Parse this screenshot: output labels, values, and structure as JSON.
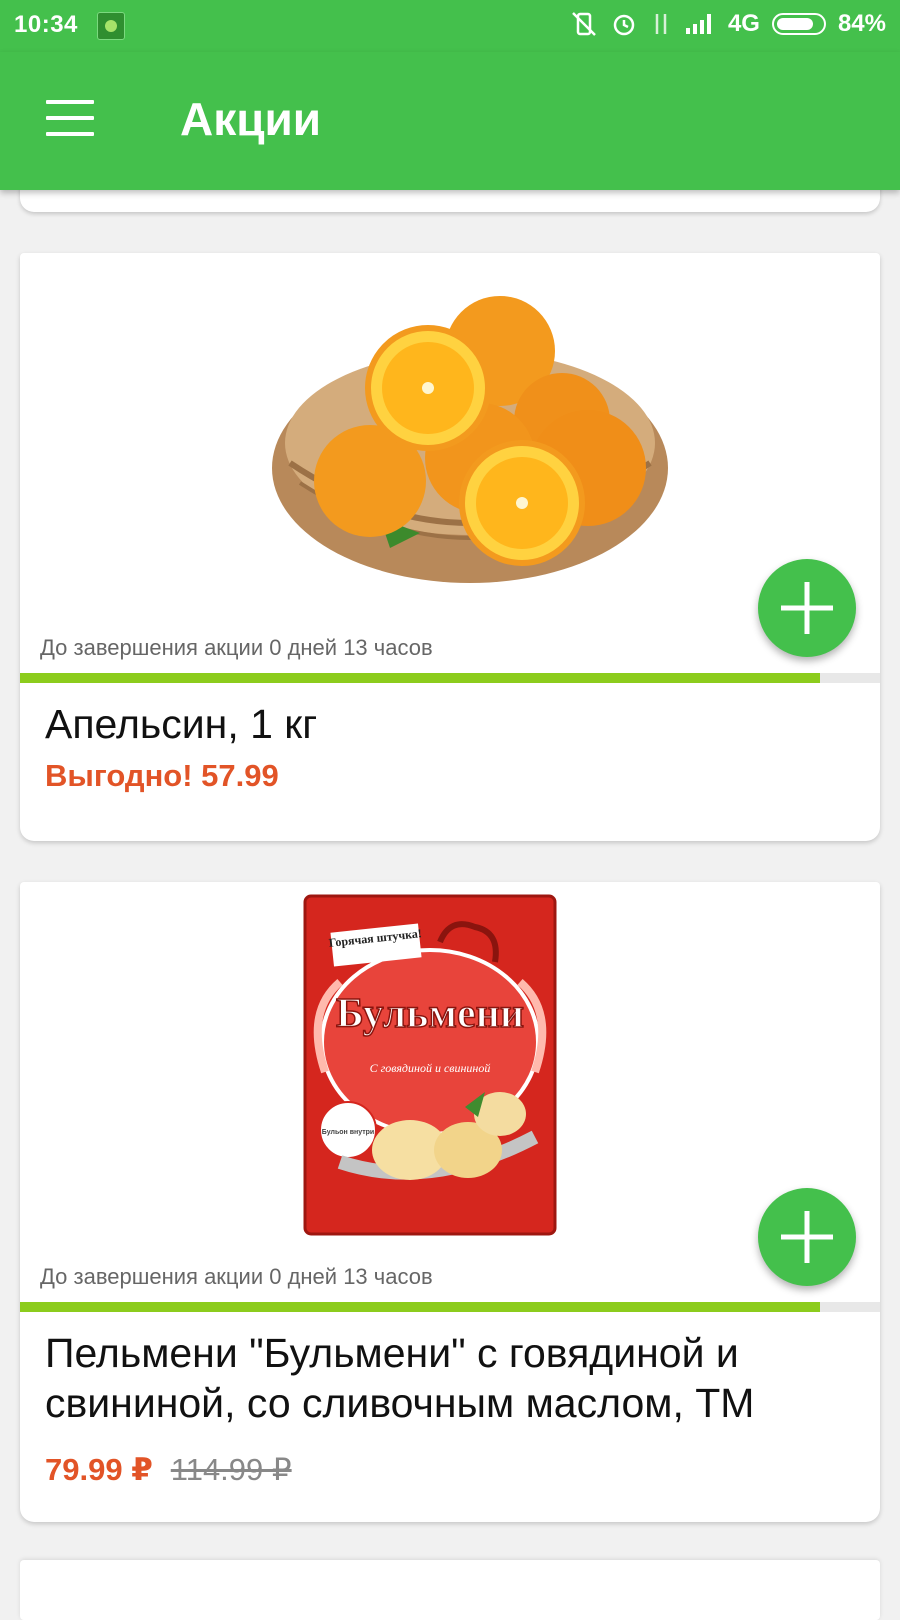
{
  "status_bar": {
    "time": "10:34",
    "network": "4G",
    "battery": "84%",
    "battery_level": 0.84
  },
  "app_bar": {
    "title": "Акции",
    "menu_icon": "hamburger-menu-icon"
  },
  "products": [
    {
      "image": "oranges-in-basket",
      "timer": "До завершения акции 0 дней 13 часов",
      "promo_progress": 0.93,
      "name": "Апельсин, 1 кг",
      "price": "Выгодно! 57.99",
      "old_price": ""
    },
    {
      "image": "bulmeni-dumplings-package",
      "image_text": {
        "brand": "Горячая штучка!",
        "product": "Бульмени",
        "flavor": "С говядиной и свининой",
        "badge": "Бульон внутри"
      },
      "timer": "До завершения акции 0 дней 13 часов",
      "promo_progress": 0.93,
      "name": "Пельмени \"Бульмени\" с говядиной и свининой, со сливочным маслом, ТМ",
      "price": "79.99 ₽",
      "old_price": "114.99 ₽"
    }
  ],
  "colors": {
    "primary": "#44c04c",
    "price": "#e25427",
    "progress": "#8ccc1d"
  }
}
